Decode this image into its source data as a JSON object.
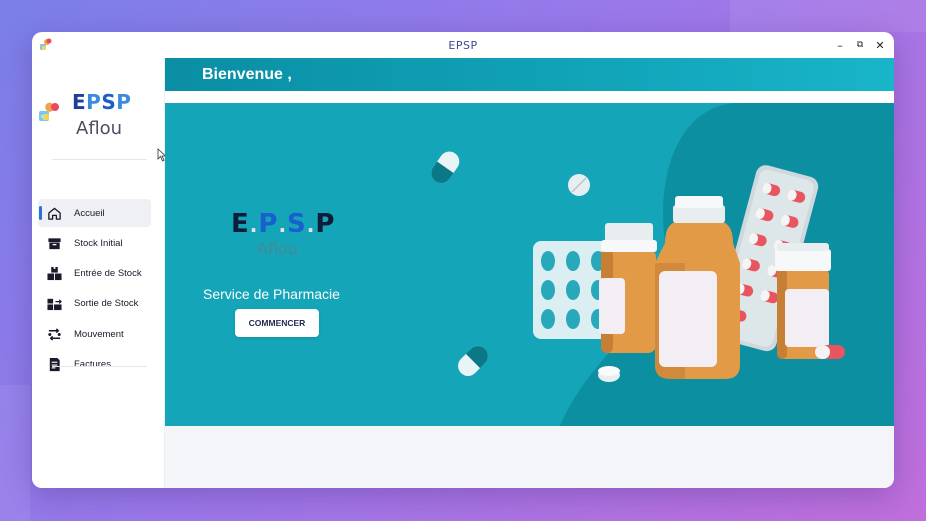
{
  "window": {
    "title": "EPSP"
  },
  "window_controls": {
    "minimize": "–",
    "maximize": "⧉",
    "close": "✕"
  },
  "brand": {
    "name_e": "E",
    "name_p": "P",
    "name_s": "S",
    "name_p2": "P",
    "subtitle": "Aflou"
  },
  "sidebar": {
    "items": [
      {
        "label": "Accueil",
        "icon": "home-icon",
        "active": true
      },
      {
        "label": "Stock Initial",
        "icon": "archive-box-icon"
      },
      {
        "label": "Entrée de Stock",
        "icon": "boxes-in-icon"
      },
      {
        "label": "Sortie de Stock",
        "icon": "boxes-out-icon"
      },
      {
        "label": "Mouvement",
        "icon": "transfer-icon"
      },
      {
        "label": "Factures",
        "icon": "invoice-icon"
      }
    ]
  },
  "header": {
    "title": "Bienvenue ,"
  },
  "hero": {
    "logo_e": "E",
    "logo_p": "P",
    "logo_s": "S",
    "logo_p2": "P",
    "logo_sub": "Aflou",
    "service": "Service de Pharmacie",
    "button": "COMMENCER"
  },
  "colors": {
    "accent": "#14a5b8",
    "brand_dark": "#1f3f9a",
    "brand_light": "#3a8be0"
  }
}
